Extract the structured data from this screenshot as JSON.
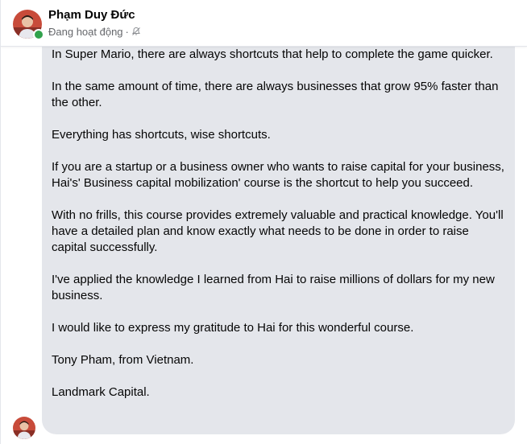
{
  "contact": {
    "name": "Phạm Duy Đức",
    "status": "Đang hoạt động",
    "status_separator": "·",
    "presence_color": "#31a24c"
  },
  "icons": {
    "mute": "bell-slash-icon"
  },
  "message": {
    "paragraphs": [
      "In Super Mario, there are always shortcuts that help to complete the game quicker.",
      "In the same amount of time, there are always businesses that grow 95% faster than the other.",
      "Everything has shortcuts, wise shortcuts.",
      "If you are a startup or a business owner who wants to raise capital for your business, Hai's' Business capital mobilization' course is the shortcut to help you succeed.",
      "With no frills, this course provides extremely valuable and practical knowledge. You'll have a detailed plan and know exactly what needs to be done in order to raise capital successfully.",
      "I've applied the knowledge I learned from Hai to raise millions of dollars for my new business.",
      "I would like to express my gratitude to Hai for this wonderful course.",
      "Tony Pham, from Vietnam.",
      "Landmark Capital."
    ],
    "bubble_color": "#e4e6eb"
  }
}
